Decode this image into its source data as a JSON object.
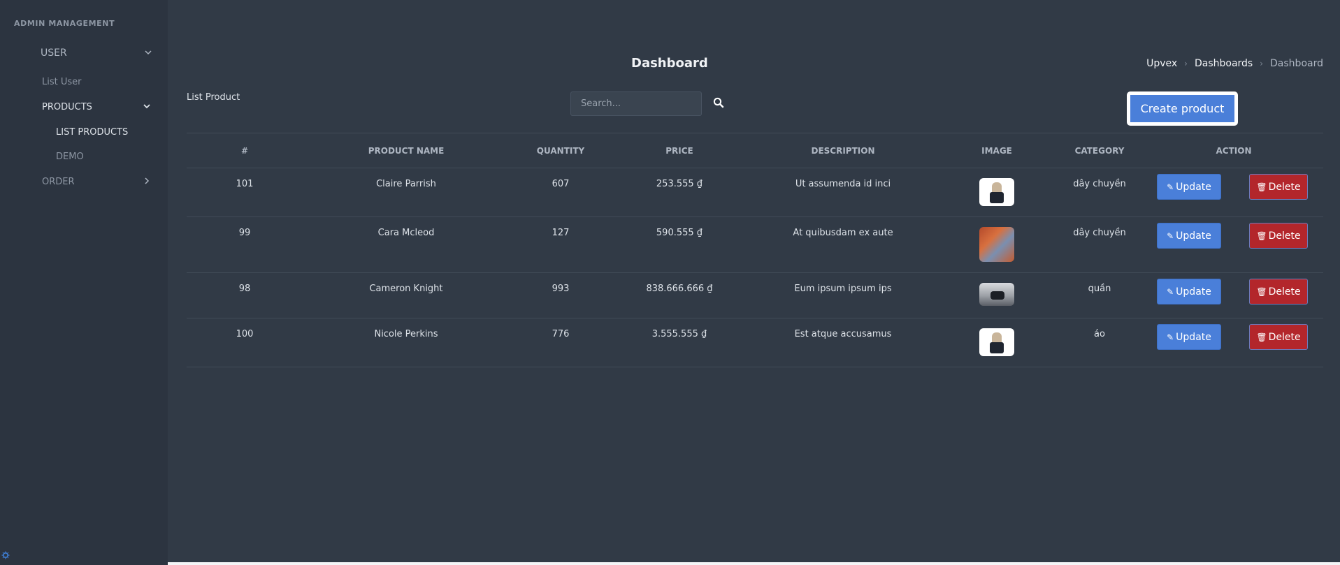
{
  "sidebar": {
    "heading": "ADMIN MANAGEMENT",
    "items": {
      "user": "USER",
      "list_user": "List User",
      "products": "PRODUCTS",
      "list_products": "LIST PRODUCTS",
      "demo": "DEMO",
      "order": "ORDER"
    },
    "icons": {
      "expanded": "chevron-down-icon",
      "collapsed": "chevron-right-icon",
      "settings": "gear-icon"
    }
  },
  "header": {
    "title": "Dashboard",
    "breadcrumb": [
      "Upvex",
      "Dashboards",
      "Dashboard"
    ]
  },
  "main": {
    "list_label": "List Product",
    "search": {
      "placeholder": "Search..."
    },
    "create_label": "Create product"
  },
  "table": {
    "columns": [
      "#",
      "PRODUCT NAME",
      "QUANTITY",
      "PRICE",
      "DESCRIPTION",
      "IMAGE",
      "CATEGORY",
      "ACTION"
    ],
    "rows": [
      {
        "id": "101",
        "name": "Claire Parrish",
        "quantity": "607",
        "price": "253.555 ₫",
        "description": "Ut assumenda id inci",
        "image": "dress-doll-photo",
        "category": "dây chuyền",
        "update": "Update",
        "delete": "Delete"
      },
      {
        "id": "99",
        "name": "Cara Mcleod",
        "quantity": "127",
        "price": "590.555 ₫",
        "description": "At quibusdam ex aute",
        "image": "colorful-art-photo",
        "category": "dây chuyền",
        "update": "Update",
        "delete": "Delete"
      },
      {
        "id": "98",
        "name": "Cameron Knight",
        "quantity": "993",
        "price": "838.666.666 ₫",
        "description": "Eum ipsum ipsum ips",
        "image": "street-photo",
        "category": "quần",
        "update": "Update",
        "delete": "Delete"
      },
      {
        "id": "100",
        "name": "Nicole Perkins",
        "quantity": "776",
        "price": "3.555.555 ₫",
        "description": "Est atque accusamus",
        "image": "dress-doll-photo",
        "category": "áo",
        "update": "Update",
        "delete": "Delete"
      }
    ]
  },
  "colors": {
    "primary": "#4a7fd9",
    "danger": "#b3262b",
    "background": "#313a46",
    "sidebar": "#2c3440"
  }
}
